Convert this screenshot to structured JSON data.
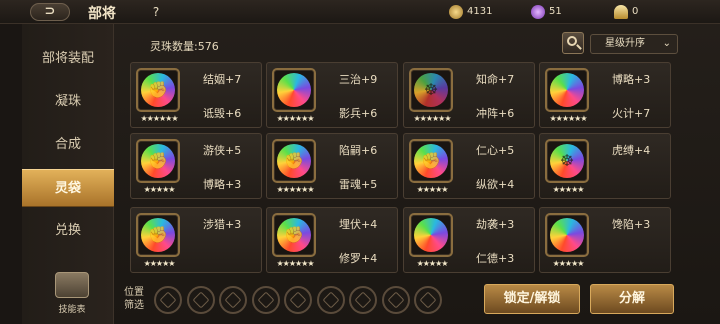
{
  "header": {
    "back_symbol": "⊃",
    "title": "部将",
    "help_symbol": "?",
    "resources": [
      {
        "icon": "gold-coin-icon",
        "value": "4131",
        "color": "#c9a24a"
      },
      {
        "icon": "purple-gem-icon",
        "value": "51",
        "color": "#a45bd6"
      },
      {
        "icon": "gold-pile-icon",
        "value": "0",
        "color": "#e0c070"
      }
    ]
  },
  "sidebar": {
    "items": [
      {
        "label": "部将装配",
        "active": false
      },
      {
        "label": "凝珠",
        "active": false
      },
      {
        "label": "合成",
        "active": false
      },
      {
        "label": "灵袋",
        "active": true
      },
      {
        "label": "兑换",
        "active": false
      }
    ],
    "skill_book_label": "技能表"
  },
  "main": {
    "count_label": "灵珠数量:576",
    "sort_label": "星级升序",
    "sort_chevron": "⌄",
    "position_filter_label": "位置\n筛选",
    "lock_button": "锁定/解锁",
    "decompose_button": "分解"
  },
  "cards": [
    {
      "attrs": [
        "结姻+7",
        "诋毁+6"
      ],
      "stars": "★★★★★★",
      "orb": "rainbow",
      "symbol": "✊"
    },
    {
      "attrs": [
        "三治+9",
        "影兵+6"
      ],
      "stars": "★★★★★★",
      "orb": "rainbow",
      "symbol": ""
    },
    {
      "attrs": [
        "知命+7",
        "冲阵+6"
      ],
      "stars": "★★★★★★",
      "orb": "rainbow-dark",
      "symbol": "☸"
    },
    {
      "attrs": [
        "博略+3",
        "火计+7"
      ],
      "stars": "★★★★★★",
      "orb": "rainbow",
      "symbol": ""
    },
    {
      "attrs": [
        "游侠+5",
        "博略+3"
      ],
      "stars": "★★★★★",
      "orb": "rainbow",
      "symbol": "✊"
    },
    {
      "attrs": [
        "陷嗣+6",
        "雷魂+5"
      ],
      "stars": "★★★★★★",
      "orb": "rainbow",
      "symbol": "✊"
    },
    {
      "attrs": [
        "仁心+5",
        "纵欲+4"
      ],
      "stars": "★★★★★",
      "orb": "rainbow",
      "symbol": "✊"
    },
    {
      "attrs": [
        "虎缚+4",
        ""
      ],
      "stars": "★★★★★",
      "orb": "rainbow",
      "symbol": "☸"
    },
    {
      "attrs": [
        "涉猎+3",
        ""
      ],
      "stars": "★★★★★",
      "orb": "rainbow",
      "symbol": "✊"
    },
    {
      "attrs": [
        "埋伏+4",
        "修罗+4"
      ],
      "stars": "★★★★★★",
      "orb": "rainbow",
      "symbol": "✊"
    },
    {
      "attrs": [
        "劫袭+3",
        "仁德+3"
      ],
      "stars": "★★★★★",
      "orb": "rainbow",
      "symbol": ""
    },
    {
      "attrs": [
        "馋陷+3",
        ""
      ],
      "stars": "★★★★★",
      "orb": "rainbow",
      "symbol": ""
    }
  ],
  "colors": {
    "accent_gold": "#e2b15a",
    "card_border": "#4a3e32",
    "orb_frame": "#8a6d3f"
  }
}
